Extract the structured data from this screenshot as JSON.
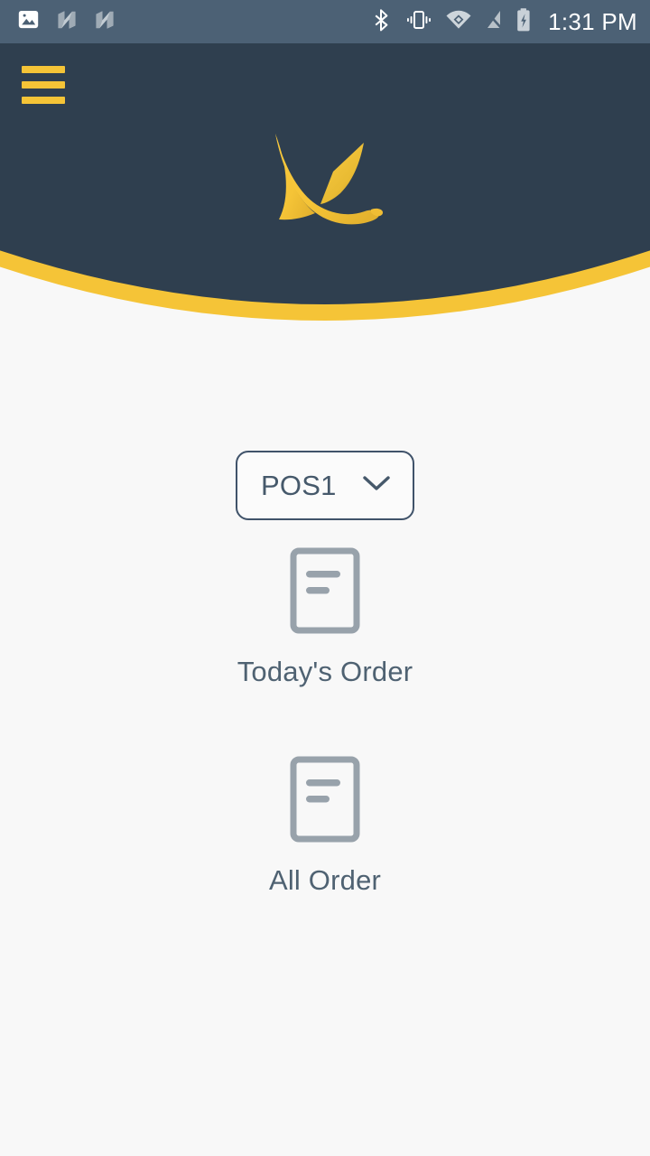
{
  "status_bar": {
    "background_color": "#4c6175",
    "clock": "1:31 PM",
    "left_icons": [
      {
        "name": "photo-image-icon",
        "label": "Screenshot captured"
      },
      {
        "name": "android-nougat-icon-1",
        "label": "Android N"
      },
      {
        "name": "android-nougat-icon-2",
        "label": "Android N"
      }
    ],
    "right_icons": [
      {
        "name": "bluetooth-icon",
        "label": "Bluetooth on"
      },
      {
        "name": "vibrate-mode-icon",
        "label": "Vibrate"
      },
      {
        "name": "wifi-vpn-icon",
        "label": "Wi-Fi with VPN"
      },
      {
        "name": "no-sim-signal-icon",
        "label": "No signal"
      },
      {
        "name": "battery-charging-icon",
        "label": "Charging"
      }
    ]
  },
  "header": {
    "background_color": "#2f3f4f",
    "accent_color": "#f5c437",
    "menu_button_label": "Open navigation menu",
    "logo_name": "flying-bird-logo",
    "logo_color": "#f7c73c"
  },
  "main": {
    "background_color": "#f8f8f8",
    "pos_selector": {
      "label": "POS terminal",
      "value": "POS1",
      "chevron": "chevron-down-icon",
      "border_color": "#40536a",
      "text_color": "#46596b"
    },
    "tiles": [
      {
        "id": "todays-order",
        "label": "Today's Order",
        "icon": "document-lines-icon",
        "icon_color": "#98a2ab",
        "label_color": "#4f6272"
      },
      {
        "id": "all-order",
        "label": "All Order",
        "icon": "document-lines-icon",
        "icon_color": "#98a2ab",
        "label_color": "#4f6272"
      }
    ]
  }
}
